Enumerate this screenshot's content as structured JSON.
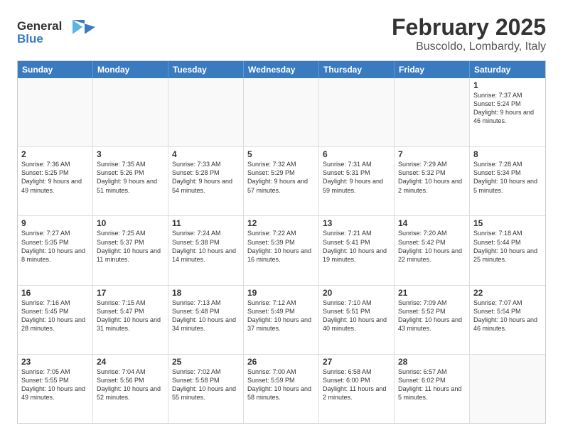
{
  "logo": {
    "line1": "General",
    "line2": "Blue"
  },
  "title": "February 2025",
  "subtitle": "Buscoldo, Lombardy, Italy",
  "header": {
    "days": [
      "Sunday",
      "Monday",
      "Tuesday",
      "Wednesday",
      "Thursday",
      "Friday",
      "Saturday"
    ]
  },
  "rows": [
    [
      {
        "day": "",
        "text": ""
      },
      {
        "day": "",
        "text": ""
      },
      {
        "day": "",
        "text": ""
      },
      {
        "day": "",
        "text": ""
      },
      {
        "day": "",
        "text": ""
      },
      {
        "day": "",
        "text": ""
      },
      {
        "day": "1",
        "text": "Sunrise: 7:37 AM\nSunset: 5:24 PM\nDaylight: 9 hours and 46 minutes."
      }
    ],
    [
      {
        "day": "2",
        "text": "Sunrise: 7:36 AM\nSunset: 5:25 PM\nDaylight: 9 hours and 49 minutes."
      },
      {
        "day": "3",
        "text": "Sunrise: 7:35 AM\nSunset: 5:26 PM\nDaylight: 9 hours and 51 minutes."
      },
      {
        "day": "4",
        "text": "Sunrise: 7:33 AM\nSunset: 5:28 PM\nDaylight: 9 hours and 54 minutes."
      },
      {
        "day": "5",
        "text": "Sunrise: 7:32 AM\nSunset: 5:29 PM\nDaylight: 9 hours and 57 minutes."
      },
      {
        "day": "6",
        "text": "Sunrise: 7:31 AM\nSunset: 5:31 PM\nDaylight: 9 hours and 59 minutes."
      },
      {
        "day": "7",
        "text": "Sunrise: 7:29 AM\nSunset: 5:32 PM\nDaylight: 10 hours and 2 minutes."
      },
      {
        "day": "8",
        "text": "Sunrise: 7:28 AM\nSunset: 5:34 PM\nDaylight: 10 hours and 5 minutes."
      }
    ],
    [
      {
        "day": "9",
        "text": "Sunrise: 7:27 AM\nSunset: 5:35 PM\nDaylight: 10 hours and 8 minutes."
      },
      {
        "day": "10",
        "text": "Sunrise: 7:25 AM\nSunset: 5:37 PM\nDaylight: 10 hours and 11 minutes."
      },
      {
        "day": "11",
        "text": "Sunrise: 7:24 AM\nSunset: 5:38 PM\nDaylight: 10 hours and 14 minutes."
      },
      {
        "day": "12",
        "text": "Sunrise: 7:22 AM\nSunset: 5:39 PM\nDaylight: 10 hours and 16 minutes."
      },
      {
        "day": "13",
        "text": "Sunrise: 7:21 AM\nSunset: 5:41 PM\nDaylight: 10 hours and 19 minutes."
      },
      {
        "day": "14",
        "text": "Sunrise: 7:20 AM\nSunset: 5:42 PM\nDaylight: 10 hours and 22 minutes."
      },
      {
        "day": "15",
        "text": "Sunrise: 7:18 AM\nSunset: 5:44 PM\nDaylight: 10 hours and 25 minutes."
      }
    ],
    [
      {
        "day": "16",
        "text": "Sunrise: 7:16 AM\nSunset: 5:45 PM\nDaylight: 10 hours and 28 minutes."
      },
      {
        "day": "17",
        "text": "Sunrise: 7:15 AM\nSunset: 5:47 PM\nDaylight: 10 hours and 31 minutes."
      },
      {
        "day": "18",
        "text": "Sunrise: 7:13 AM\nSunset: 5:48 PM\nDaylight: 10 hours and 34 minutes."
      },
      {
        "day": "19",
        "text": "Sunrise: 7:12 AM\nSunset: 5:49 PM\nDaylight: 10 hours and 37 minutes."
      },
      {
        "day": "20",
        "text": "Sunrise: 7:10 AM\nSunset: 5:51 PM\nDaylight: 10 hours and 40 minutes."
      },
      {
        "day": "21",
        "text": "Sunrise: 7:09 AM\nSunset: 5:52 PM\nDaylight: 10 hours and 43 minutes."
      },
      {
        "day": "22",
        "text": "Sunrise: 7:07 AM\nSunset: 5:54 PM\nDaylight: 10 hours and 46 minutes."
      }
    ],
    [
      {
        "day": "23",
        "text": "Sunrise: 7:05 AM\nSunset: 5:55 PM\nDaylight: 10 hours and 49 minutes."
      },
      {
        "day": "24",
        "text": "Sunrise: 7:04 AM\nSunset: 5:56 PM\nDaylight: 10 hours and 52 minutes."
      },
      {
        "day": "25",
        "text": "Sunrise: 7:02 AM\nSunset: 5:58 PM\nDaylight: 10 hours and 55 minutes."
      },
      {
        "day": "26",
        "text": "Sunrise: 7:00 AM\nSunset: 5:59 PM\nDaylight: 10 hours and 58 minutes."
      },
      {
        "day": "27",
        "text": "Sunrise: 6:58 AM\nSunset: 6:00 PM\nDaylight: 11 hours and 2 minutes."
      },
      {
        "day": "28",
        "text": "Sunrise: 6:57 AM\nSunset: 6:02 PM\nDaylight: 11 hours and 5 minutes."
      },
      {
        "day": "",
        "text": ""
      }
    ]
  ]
}
